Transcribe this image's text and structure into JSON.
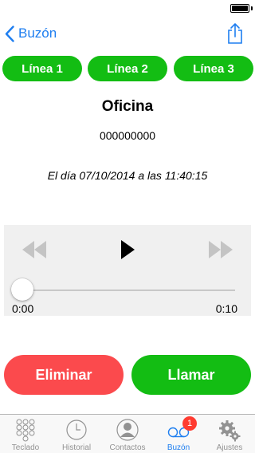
{
  "status_bar": {
    "battery_level": 1.0
  },
  "nav": {
    "back_label": "Buzón"
  },
  "line_tabs": [
    "Línea 1",
    "Línea 2",
    "Línea 3"
  ],
  "message": {
    "name": "Oficina",
    "number": "000000000",
    "date_text": "El día 07/10/2014 a las 11:40:15"
  },
  "player": {
    "elapsed": "0:00",
    "total": "0:10",
    "progress": 0
  },
  "actions": {
    "delete_label": "Eliminar",
    "call_label": "Llamar"
  },
  "tab_bar": {
    "items": [
      "Teclado",
      "Historial",
      "Contactos",
      "Buzón",
      "Ajustes"
    ],
    "active": "Buzón",
    "voicemail_badge": "1"
  },
  "colors": {
    "accent": "#1e7ef0",
    "green": "#13bd13",
    "red": "#fb4a4d",
    "badge": "#ff3b30"
  }
}
